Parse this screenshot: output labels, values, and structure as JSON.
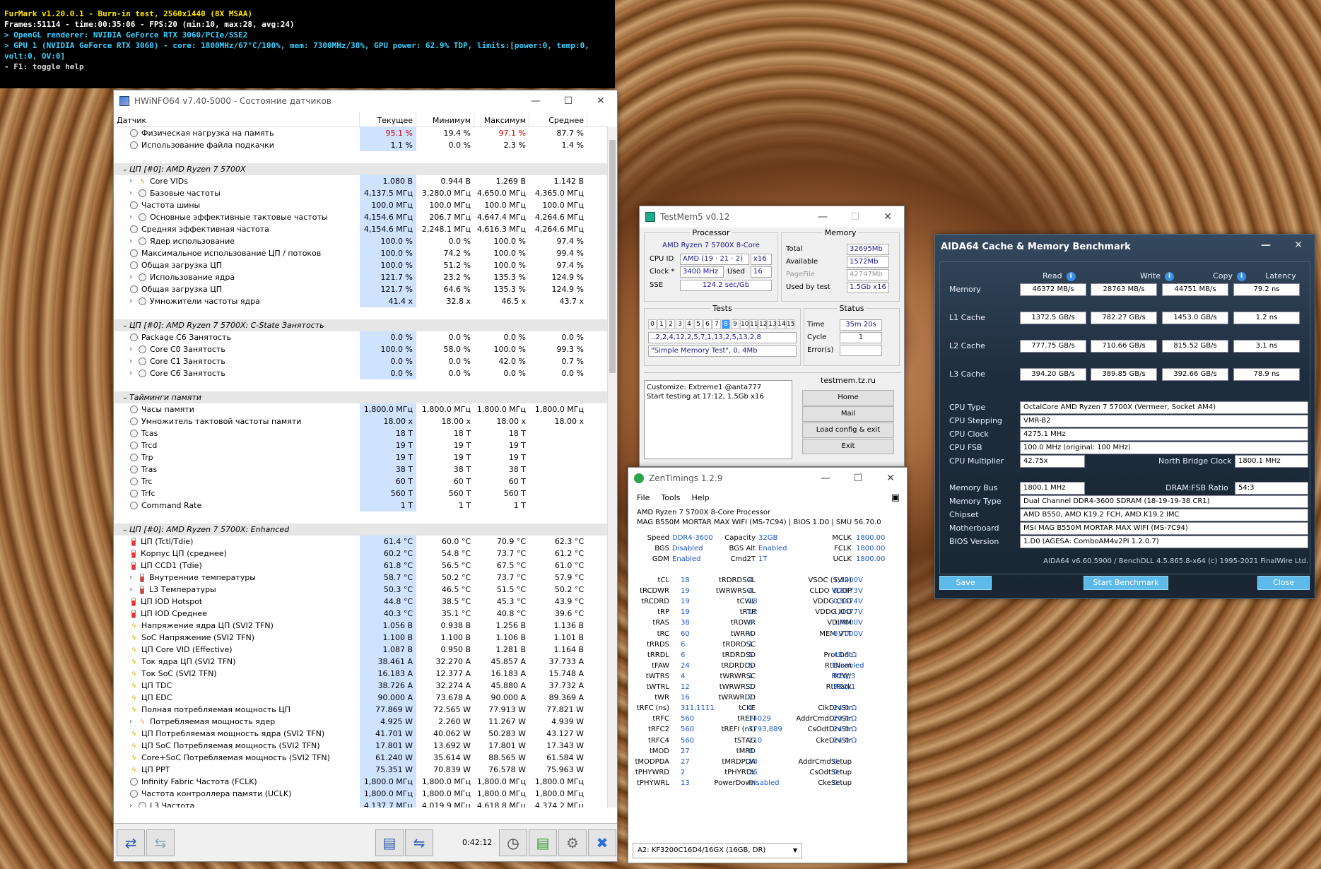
{
  "furmark": {
    "l1": "FurMark v1.20.0.1 - Burn-in test, 2560x1440 (8X MSAA)",
    "l2": "Frames:51114 - time:00:35:06 - FPS:20 (min:10, max:28, avg:24)",
    "l3": "> OpenGL renderer: NVIDIA GeForce RTX 3060/PCIe/SSE2",
    "l4": "> GPU 1 (NVIDIA GeForce RTX 3060) - core: 1800MHz/67°C/100%, mem: 7300MHz/38%, GPU power: 62.9% TDP, limits:[power:0, temp:0, volt:0, OV:0]",
    "l5": "- F1: toggle help"
  },
  "hwinfo": {
    "title": "HWiNFO64 v7.40-5000 - Состояние датчиков",
    "headers": [
      "Датчик",
      "Текущее",
      "Минимум",
      "Максимум",
      "Среднее"
    ],
    "time": "0:42:12",
    "rows": [
      {
        "k": "s",
        "ic": "c",
        "ind": 0,
        "n": "Физическая нагрузка на память",
        "v": [
          "95.1 %",
          "19.4 %",
          "97.1 %",
          "87.7 %"
        ],
        "red": [
          0,
          2
        ]
      },
      {
        "k": "s",
        "ic": "c",
        "ind": 0,
        "n": "Использование файла подкачки",
        "v": [
          "1.1 %",
          "0.0 %",
          "2.3 %",
          "1.4 %"
        ]
      },
      {
        "k": "sp"
      },
      {
        "k": "g",
        "n": "ЦП [#0]: AMD Ryzen 7 5700X"
      },
      {
        "k": "s",
        "ic": "b",
        "ind": 1,
        "x": 1,
        "n": "Core VIDs",
        "v": [
          "1.080 В",
          "0.944 В",
          "1.269 В",
          "1.142 В"
        ]
      },
      {
        "k": "s",
        "ic": "c",
        "ind": 1,
        "x": 1,
        "n": "Базовые частоты",
        "v": [
          "4,137.5 МГц",
          "3,280.0 МГц",
          "4,650.0 МГц",
          "4,365.0 МГц"
        ]
      },
      {
        "k": "s",
        "ic": "c",
        "ind": 0,
        "n": "Частота шины",
        "v": [
          "100.0 МГц",
          "100.0 МГц",
          "100.0 МГц",
          "100.0 МГц"
        ]
      },
      {
        "k": "s",
        "ic": "c",
        "ind": 1,
        "x": 1,
        "n": "Основные эффективные тактовые частоты",
        "v": [
          "4,154.6 МГц",
          "206.7 МГц",
          "4,647.4 МГц",
          "4,264.6 МГц"
        ]
      },
      {
        "k": "s",
        "ic": "c",
        "ind": 0,
        "n": "Средняя эффективная частота",
        "v": [
          "4,154.6 МГц",
          "2,248.1 МГц",
          "4,616.3 МГц",
          "4,264.6 МГц"
        ]
      },
      {
        "k": "s",
        "ic": "c",
        "ind": 1,
        "x": 1,
        "n": "Ядер использование",
        "v": [
          "100.0 %",
          "0.0 %",
          "100.0 %",
          "97.4 %"
        ]
      },
      {
        "k": "s",
        "ic": "c",
        "ind": 0,
        "n": "Максимальное использование ЦП / потоков",
        "v": [
          "100.0 %",
          "74.2 %",
          "100.0 %",
          "99.4 %"
        ]
      },
      {
        "k": "s",
        "ic": "c",
        "ind": 0,
        "n": "Общая загрузка ЦП",
        "v": [
          "100.0 %",
          "51.2 %",
          "100.0 %",
          "97.4 %"
        ]
      },
      {
        "k": "s",
        "ic": "c",
        "ind": 1,
        "x": 1,
        "n": "Использование ядра",
        "v": [
          "121.7 %",
          "23.2 %",
          "135.3 %",
          "124.9 %"
        ]
      },
      {
        "k": "s",
        "ic": "c",
        "ind": 0,
        "n": "Общая загрузка ЦП",
        "v": [
          "121.7 %",
          "64.6 %",
          "135.3 %",
          "124.9 %"
        ]
      },
      {
        "k": "s",
        "ic": "c",
        "ind": 1,
        "x": 1,
        "n": "Умножители частоты ядра",
        "v": [
          "41.4 x",
          "32.8 x",
          "46.5 x",
          "43.7 x"
        ]
      },
      {
        "k": "sp"
      },
      {
        "k": "g",
        "n": "ЦП [#0]: AMD Ryzen 7 5700X: C-State Занятость"
      },
      {
        "k": "s",
        "ic": "c",
        "ind": 0,
        "n": "Package C6 Занятость",
        "v": [
          "0.0 %",
          "0.0 %",
          "0.0 %",
          "0.0 %"
        ]
      },
      {
        "k": "s",
        "ic": "c",
        "ind": 1,
        "x": 1,
        "n": "Core C0 Занятость",
        "v": [
          "100.0 %",
          "58.0 %",
          "100.0 %",
          "99.3 %"
        ]
      },
      {
        "k": "s",
        "ic": "c",
        "ind": 1,
        "x": 1,
        "n": "Core C1 Занятость",
        "v": [
          "0.0 %",
          "0.0 %",
          "42.0 %",
          "0.7 %"
        ]
      },
      {
        "k": "s",
        "ic": "c",
        "ind": 1,
        "x": 1,
        "n": "Core C6 Занятость",
        "v": [
          "0.0 %",
          "0.0 %",
          "0.0 %",
          "0.0 %"
        ]
      },
      {
        "k": "sp"
      },
      {
        "k": "g",
        "n": "Тайминги памяти"
      },
      {
        "k": "s",
        "ic": "c",
        "ind": 0,
        "n": "Часы памяти",
        "v": [
          "1,800.0 МГц",
          "1,800.0 МГц",
          "1,800.0 МГц",
          "1,800.0 МГц"
        ]
      },
      {
        "k": "s",
        "ic": "c",
        "ind": 0,
        "n": "Умножитель тактовой частоты памяти",
        "v": [
          "18.00 x",
          "18.00 x",
          "18.00 x",
          "18.00 x"
        ]
      },
      {
        "k": "s",
        "ic": "c",
        "ind": 0,
        "n": "Tcas",
        "v": [
          "18 T",
          "18 T",
          "18 T",
          ""
        ]
      },
      {
        "k": "s",
        "ic": "c",
        "ind": 0,
        "n": "Trcd",
        "v": [
          "19 T",
          "19 T",
          "19 T",
          ""
        ]
      },
      {
        "k": "s",
        "ic": "c",
        "ind": 0,
        "n": "Trp",
        "v": [
          "19 T",
          "19 T",
          "19 T",
          ""
        ]
      },
      {
        "k": "s",
        "ic": "c",
        "ind": 0,
        "n": "Tras",
        "v": [
          "38 T",
          "38 T",
          "38 T",
          ""
        ]
      },
      {
        "k": "s",
        "ic": "c",
        "ind": 0,
        "n": "Trc",
        "v": [
          "60 T",
          "60 T",
          "60 T",
          ""
        ]
      },
      {
        "k": "s",
        "ic": "c",
        "ind": 0,
        "n": "Trfc",
        "v": [
          "560 T",
          "560 T",
          "560 T",
          ""
        ]
      },
      {
        "k": "s",
        "ic": "c",
        "ind": 0,
        "n": "Command Rate",
        "v": [
          "1 T",
          "1 T",
          "1 T",
          ""
        ]
      },
      {
        "k": "sp"
      },
      {
        "k": "g",
        "n": "ЦП [#0]: AMD Ryzen 7 5700X: Enhanced"
      },
      {
        "k": "s",
        "ic": "t",
        "ind": 0,
        "n": "ЦП (Tctl/Tdie)",
        "v": [
          "61.4 °C",
          "60.0 °C",
          "70.9 °C",
          "62.3 °C"
        ]
      },
      {
        "k": "s",
        "ic": "t",
        "ind": 0,
        "n": "Корпус ЦП (среднее)",
        "v": [
          "60.2 °C",
          "54.8 °C",
          "73.7 °C",
          "61.2 °C"
        ]
      },
      {
        "k": "s",
        "ic": "t",
        "ind": 0,
        "n": "ЦП CCD1 (Tdie)",
        "v": [
          "61.8 °C",
          "56.5 °C",
          "67.5 °C",
          "61.0 °C"
        ]
      },
      {
        "k": "s",
        "ic": "t",
        "ind": 1,
        "x": 1,
        "n": "Внутренние температуры",
        "v": [
          "58.7 °C",
          "50.2 °C",
          "73.7 °C",
          "57.9 °C"
        ]
      },
      {
        "k": "s",
        "ic": "t",
        "ind": 1,
        "x": 1,
        "n": "L3 Температуры",
        "v": [
          "50.3 °C",
          "46.5 °C",
          "51.5 °C",
          "50.2 °C"
        ]
      },
      {
        "k": "s",
        "ic": "t",
        "ind": 0,
        "n": "ЦП IOD Hotspot",
        "v": [
          "44.8 °C",
          "38.5 °C",
          "45.3 °C",
          "43.9 °C"
        ]
      },
      {
        "k": "s",
        "ic": "t",
        "ind": 0,
        "n": "ЦП IOD Среднее",
        "v": [
          "40.3 °C",
          "35.1 °C",
          "40.8 °C",
          "39.6 °C"
        ]
      },
      {
        "k": "s",
        "ic": "b",
        "ind": 0,
        "n": "Напряжение ядра ЦП (SVI2 TFN)",
        "v": [
          "1.056 В",
          "0.938 В",
          "1.256 В",
          "1.136 В"
        ]
      },
      {
        "k": "s",
        "ic": "b",
        "ind": 0,
        "n": "SoC Напряжение (SVI2 TFN)",
        "v": [
          "1.100 В",
          "1.100 В",
          "1.106 В",
          "1.101 В"
        ]
      },
      {
        "k": "s",
        "ic": "b",
        "ind": 0,
        "n": "ЦП Core VID (Effective)",
        "v": [
          "1.087 В",
          "0.950 В",
          "1.281 В",
          "1.164 В"
        ]
      },
      {
        "k": "s",
        "ic": "b",
        "ind": 0,
        "n": "Ток ядра ЦП (SVI2 TFN)",
        "v": [
          "38.461 A",
          "32.270 A",
          "45.857 A",
          "37.733 A"
        ]
      },
      {
        "k": "s",
        "ic": "b",
        "ind": 0,
        "n": "Ток SoC (SVI2 TFN)",
        "v": [
          "16.183 A",
          "12.377 A",
          "16.183 A",
          "15.748 A"
        ]
      },
      {
        "k": "s",
        "ic": "b",
        "ind": 0,
        "n": "ЦП TDC",
        "v": [
          "38.726 A",
          "32.274 A",
          "45.880 A",
          "37.732 A"
        ]
      },
      {
        "k": "s",
        "ic": "b",
        "ind": 0,
        "n": "ЦП EDC",
        "v": [
          "90.000 A",
          "73.678 A",
          "90.000 A",
          "89.369 A"
        ]
      },
      {
        "k": "s",
        "ic": "b",
        "ind": 0,
        "n": "Полная потребляемая мощность ЦП",
        "v": [
          "77.869 W",
          "72.565 W",
          "77.913 W",
          "77.821 W"
        ]
      },
      {
        "k": "s",
        "ic": "b",
        "ind": 1,
        "x": 1,
        "n": "Потребляемая мощность ядер",
        "v": [
          "4.925 W",
          "2.260 W",
          "11.267 W",
          "4.939 W"
        ]
      },
      {
        "k": "s",
        "ic": "b",
        "ind": 0,
        "n": "ЦП Потребляемая мощность ядра (SVI2 TFN)",
        "v": [
          "41.701 W",
          "40.062 W",
          "50.283 W",
          "43.127 W"
        ]
      },
      {
        "k": "s",
        "ic": "b",
        "ind": 0,
        "n": "ЦП SoC Потребляемая мощность (SVI2 TFN)",
        "v": [
          "17.801 W",
          "13.692 W",
          "17.801 W",
          "17.343 W"
        ]
      },
      {
        "k": "s",
        "ic": "b",
        "ind": 0,
        "n": "Core+SoC Потребляемая мощность (SVI2 TFN)",
        "v": [
          "61.240 W",
          "35.614 W",
          "88.565 W",
          "61.584 W"
        ]
      },
      {
        "k": "s",
        "ic": "b",
        "ind": 0,
        "n": "ЦП PPT",
        "v": [
          "75.351 W",
          "70.839 W",
          "76.578 W",
          "75.963 W"
        ]
      },
      {
        "k": "s",
        "ic": "c",
        "ind": 0,
        "n": "Infinity Fabric Частота (FCLK)",
        "v": [
          "1,800.0 МГц",
          "1,800.0 МГц",
          "1,800.0 МГц",
          "1,800.0 МГц"
        ]
      },
      {
        "k": "s",
        "ic": "c",
        "ind": 0,
        "n": "Частота контроллера памяти (UCLK)",
        "v": [
          "1,800.0 МГц",
          "1,800.0 МГц",
          "1,800.0 МГц",
          "1,800.0 МГц"
        ]
      },
      {
        "k": "s",
        "ic": "c",
        "ind": 1,
        "x": 1,
        "n": "L3 Частота",
        "v": [
          "4,137.7 МГц",
          "4,019.9 МГц",
          "4,618.8 МГц",
          "4,374.2 МГц"
        ]
      }
    ]
  },
  "testmem": {
    "title": "TestMem5 v0.12",
    "processor_legend": "Processor",
    "processor_name": "AMD Ryzen 7 5700X 8-Core",
    "cpuid_label": "CPU ID",
    "cpuid": "AMD  (19 · 21 · 2)",
    "threads": "x16",
    "clock_label": "Clock *",
    "clock": "3400 MHz",
    "used_label": "Used",
    "used": "16",
    "sse_label": "SSE",
    "sse": "124.2 sec/Gb",
    "memory_legend": "Memory",
    "total_label": "Total",
    "total": "32695Mb",
    "avail_label": "Available",
    "avail": "1572Mb",
    "pagefile_label": "PageFile",
    "pagefile": "42747Mb",
    "usedby_label": "Used by test",
    "usedby": "1.5Gb x16",
    "tests_legend": "Tests",
    "cells": [
      "0",
      "1",
      "2",
      "3",
      "4",
      "5",
      "6",
      "7",
      "8",
      "9",
      "10",
      "11",
      "12",
      "13",
      "14",
      "15"
    ],
    "active_cell": 8,
    "seq": "..2,2,4,12,2,5,7,1,13,2,5,13,2,8",
    "test_name": "\"Simple Memory Test\", 0, 4Mb",
    "status_legend": "Status",
    "time_label": "Time",
    "time": "35m 20s",
    "cycle_label": "Cycle",
    "cycle": "1",
    "errors_label": "Error(s)",
    "errors": "",
    "log1": "Customize: Extreme1 @anta777",
    "log2": "Start testing at 17:12, 1.5Gb x16",
    "site": "testmem.tz.ru",
    "buttons": [
      "Home",
      "Mail",
      "Load config & exit",
      "Exit"
    ]
  },
  "zen": {
    "title": "ZenTimings 1.2.9",
    "menu": [
      "File",
      "Tools",
      "Help"
    ],
    "cpu": "AMD Ryzen 7 5700X 8-Core Processor",
    "board": "MAG B550M MORTAR MAX WIFI (MS-7C94) | BIOS 1.D0 | SMU 56.70.0",
    "top": [
      [
        "Speed",
        "DDR4-3600",
        "Capacity",
        "32GB",
        "MCLK",
        "1800.00"
      ],
      [
        "BGS",
        "Disabled",
        "BGS Alt",
        "Enabled",
        "FCLK",
        "1800.00"
      ],
      [
        "GDM",
        "Enabled",
        "Cmd2T",
        "1T",
        "UCLK",
        "1800.00"
      ]
    ],
    "timings": [
      [
        "tCL",
        "18",
        "tRDRDSCL",
        "4",
        "VSOC (SVI2)",
        "1,1000V"
      ],
      [
        "tRCDWR",
        "19",
        "tWRWRSCL",
        "4",
        "CLDO VDDP",
        "0,8973V"
      ],
      [
        "tRCDRD",
        "19",
        "tCWL",
        "18",
        "VDDG CCD",
        "0,9474V"
      ],
      [
        "tRP",
        "19",
        "tRTP",
        "12",
        "VDDG IOD",
        "1,0477V"
      ],
      [
        "tRAS",
        "38",
        "tRDWR",
        "8",
        "VDIMM",
        "1,4000V"
      ],
      [
        "tRC",
        "60",
        "tWRRD",
        "4",
        "MEM VTT",
        "0,7000V"
      ],
      [
        "tRRDS",
        "6",
        "tRDRDSC",
        "1",
        "",
        ""
      ],
      [
        "tRRDL",
        "6",
        "tRDRDSD",
        "5",
        "ProcOdt",
        "43.6 Ω"
      ],
      [
        "tFAW",
        "24",
        "tRDRDDD",
        "5",
        "RttNom",
        "Disabled"
      ],
      [
        "tWTRS",
        "4",
        "tWRWRSC",
        "1",
        "RttWr",
        "RZQ/3"
      ],
      [
        "tWTRL",
        "12",
        "tWRWRSD",
        "7",
        "RttPark",
        "RZQ/1"
      ],
      [
        "tWR",
        "16",
        "tWRWRDD",
        "7",
        "",
        ""
      ],
      [
        "tRFC (ns)",
        "311,1111",
        "tCKE",
        "1",
        "ClkDrvStr",
        "24.0 Ω"
      ],
      [
        "tRFC",
        "560",
        "tREFI",
        "14029",
        "AddrCmdDrvStr",
        "20.0 Ω"
      ],
      [
        "tRFC2",
        "560",
        "tREFI (ns)",
        "7793,889",
        "CsOdtDrvStr",
        "24.0 Ω"
      ],
      [
        "tRFC4",
        "560",
        "tSTAG",
        "210",
        "CkeDrvStr",
        "24.0 Ω"
      ],
      [
        "tMOD",
        "27",
        "tMRD",
        "8",
        "",
        ""
      ],
      [
        "tMODPDA",
        "27",
        "tMRDPDA",
        "18",
        "AddrCmdSetup",
        "0"
      ],
      [
        "tPHYWRD",
        "2",
        "tPHYRDL",
        "26",
        "CsOdtSetup",
        "0"
      ],
      [
        "tPHYWRL",
        "13",
        "PowerDown",
        "Disabled",
        "CkeSetup",
        "0"
      ]
    ],
    "module": "A2: KF3200C16D4/16GX (16GB, DR)"
  },
  "aida": {
    "title": "AIDA64 Cache & Memory Benchmark",
    "cols": [
      "Read",
      "Write",
      "Copy",
      "Latency"
    ],
    "bench": [
      {
        "n": "Memory",
        "v": [
          "46372 MB/s",
          "28763 MB/s",
          "44751 MB/s",
          "79.2 ns"
        ]
      },
      {
        "n": "L1 Cache",
        "v": [
          "1372.5 GB/s",
          "782.27 GB/s",
          "1453.0 GB/s",
          "1.2 ns"
        ]
      },
      {
        "n": "L2 Cache",
        "v": [
          "777.75 GB/s",
          "710.66 GB/s",
          "815.52 GB/s",
          "3.1 ns"
        ]
      },
      {
        "n": "L3 Cache",
        "v": [
          "394.20 GB/s",
          "389.85 GB/s",
          "392.66 GB/s",
          "78.9 ns"
        ]
      }
    ],
    "cpu_type_l": "CPU Type",
    "cpu_type": "OctalCore AMD Ryzen 7 5700X  (Vermeer, Socket AM4)",
    "cpu_step_l": "CPU Stepping",
    "cpu_step": "VMR-B2",
    "cpu_clock_l": "CPU Clock",
    "cpu_clock": "4275.1 MHz",
    "cpu_fsb_l": "CPU FSB",
    "cpu_fsb": "100.0 MHz  (original: 100 MHz)",
    "cpu_mult_l": "CPU Multiplier",
    "cpu_mult": "42.75x",
    "nb_l": "North Bridge Clock",
    "nb": "1800.1 MHz",
    "membus_l": "Memory Bus",
    "membus": "1800.1 MHz",
    "ratio_l": "DRAM:FSB Ratio",
    "ratio": "54:3",
    "memtype_l": "Memory Type",
    "memtype": "Dual Channel DDR4-3600 SDRAM  (18-19-19-38 CR1)",
    "chipset_l": "Chipset",
    "chipset": "AMD B550, AMD K19.2 FCH, AMD K19.2 IMC",
    "mb_l": "Motherboard",
    "mb": "MSI MAG B550M MORTAR MAX WIFI (MS-7C94)",
    "bios_l": "BIOS Version",
    "bios": "1.D0  (AGESA: ComboAM4v2PI 1.2.0.7)",
    "footer": "AIDA64 v6.60.5900 / BenchDLL 4.5.865.8-x64  (c) 1995-2021 FinalWire Ltd.",
    "save": "Save",
    "start": "Start Benchmark",
    "close": "Close"
  }
}
